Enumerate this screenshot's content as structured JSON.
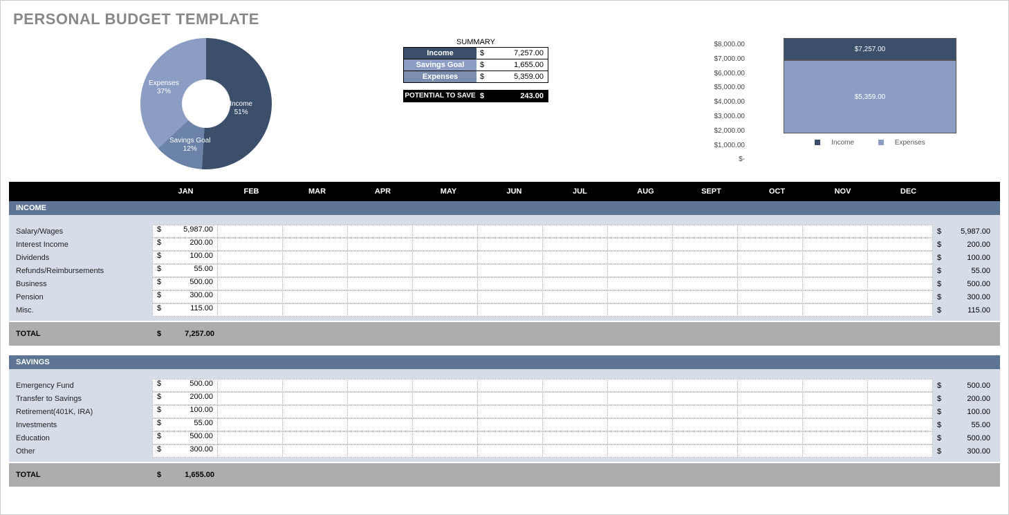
{
  "title": "PERSONAL BUDGET TEMPLATE",
  "donut": {
    "income": {
      "label": "Income",
      "pct": "51%",
      "value": 51
    },
    "expenses": {
      "label": "Expenses",
      "pct": "37%",
      "value": 37
    },
    "savings": {
      "label": "Savings Goal",
      "pct": "12%",
      "value": 12
    }
  },
  "summary": {
    "title": "SUMMARY",
    "rows": [
      {
        "label": "Income",
        "value": "7,257.00",
        "color": "#3b4f6b"
      },
      {
        "label": "Savings Goal",
        "value": "1,655.00",
        "color": "#8b9dc3"
      },
      {
        "label": "Expenses",
        "value": "5,359.00",
        "color": "#7b8eb0"
      }
    ],
    "potential_label": "POTENTIAL TO SAVE",
    "potential_value": "243.00"
  },
  "yaxis": [
    "$8,000.00",
    "$7,000.00",
    "$6,000.00",
    "$5,000.00",
    "$4,000.00",
    "$3,000.00",
    "$2,000.00",
    "$1,000.00",
    "$-"
  ],
  "bars": {
    "income": {
      "label": "$7,257.00"
    },
    "expenses": {
      "label": "$5,359.00"
    },
    "legend_income": "Income",
    "legend_expenses": "Expenses"
  },
  "months": [
    "JAN",
    "FEB",
    "MAR",
    "APR",
    "MAY",
    "JUN",
    "JUL",
    "AUG",
    "SEPT",
    "OCT",
    "NOV",
    "DEC"
  ],
  "income": {
    "head": "INCOME",
    "rows": [
      {
        "label": "Salary/Wages",
        "jan": "5,987.00",
        "total": "5,987.00"
      },
      {
        "label": "Interest Income",
        "jan": "200.00",
        "total": "200.00"
      },
      {
        "label": "Dividends",
        "jan": "100.00",
        "total": "100.00"
      },
      {
        "label": "Refunds/Reimbursements",
        "jan": "55.00",
        "total": "55.00"
      },
      {
        "label": "Business",
        "jan": "500.00",
        "total": "500.00"
      },
      {
        "label": "Pension",
        "jan": "300.00",
        "total": "300.00"
      },
      {
        "label": "Misc.",
        "jan": "115.00",
        "total": "115.00"
      }
    ],
    "total_label": "TOTAL",
    "total_jan": "7,257.00"
  },
  "savings": {
    "head": "SAVINGS",
    "rows": [
      {
        "label": "Emergency Fund",
        "jan": "500.00",
        "total": "500.00"
      },
      {
        "label": "Transfer to Savings",
        "jan": "200.00",
        "total": "200.00"
      },
      {
        "label": "Retirement(401K, IRA)",
        "jan": "100.00",
        "total": "100.00"
      },
      {
        "label": "Investments",
        "jan": "55.00",
        "total": "55.00"
      },
      {
        "label": "Education",
        "jan": "500.00",
        "total": "500.00"
      },
      {
        "label": "Other",
        "jan": "300.00",
        "total": "300.00"
      }
    ],
    "total_label": "TOTAL",
    "total_jan": "1,655.00"
  },
  "chart_data": [
    {
      "type": "pie",
      "title": "",
      "series": [
        {
          "name": "Income",
          "value": 51
        },
        {
          "name": "Expenses",
          "value": 37
        },
        {
          "name": "Savings Goal",
          "value": 12
        }
      ]
    },
    {
      "type": "bar",
      "categories": [
        "Income",
        "Expenses"
      ],
      "values": [
        7257.0,
        5359.0
      ],
      "ylim": [
        0,
        8000
      ],
      "ylabel": "",
      "xlabel": ""
    }
  ]
}
